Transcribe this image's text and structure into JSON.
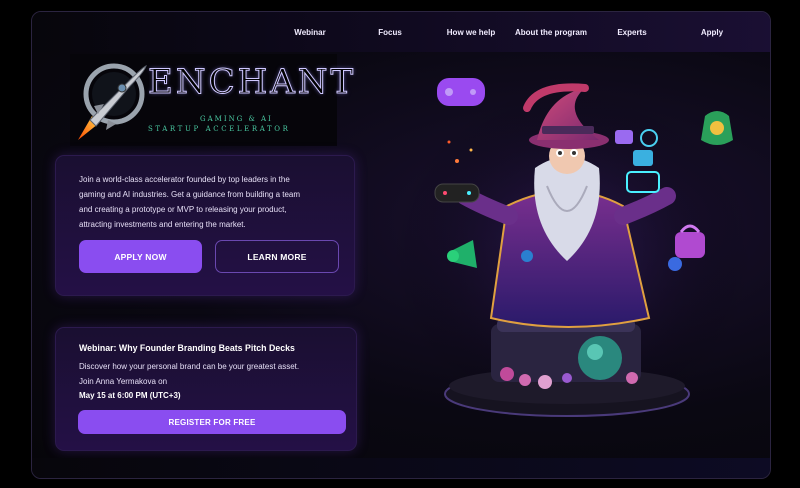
{
  "nav": {
    "items": [
      "Webinar",
      "Focus",
      "How we help",
      "About the program",
      "Experts",
      "Apply"
    ]
  },
  "logo": {
    "word": "ENCHANT",
    "subtitle_line1": "GAMING & AI",
    "subtitle_line2": "STARTUP ACCELERATOR"
  },
  "intro": {
    "description_lines": [
      "Join a world-class accelerator founded by top leaders in the",
      "gaming and AI industries. Get a guidance from building a team",
      "and creating a prototype or MVP to releasing your product,",
      "attracting investments and entering the market."
    ],
    "apply_label": "APPLY NOW",
    "learn_label": "LEARN MORE"
  },
  "webinar": {
    "title": "Webinar: Why Founder Branding Beats Pitch Decks",
    "line1": "Discover how your personal brand can be your greatest asset.",
    "line2": "Join Anna Yermakova on",
    "line3": "May 15 at 6:00 PM (UTC+3)",
    "register_label": "REGISTER FOR FREE"
  },
  "colors": {
    "accent": "#8a4df0",
    "background": "#08060e",
    "card": "#1f0f3b",
    "logo_subtitle": "#4ac9a2"
  },
  "hero": {
    "icons": [
      "game-controller-icon",
      "money-bag-icon",
      "megaphone-icon",
      "shopping-bag-icon",
      "robot-icon",
      "camera-icon"
    ]
  }
}
